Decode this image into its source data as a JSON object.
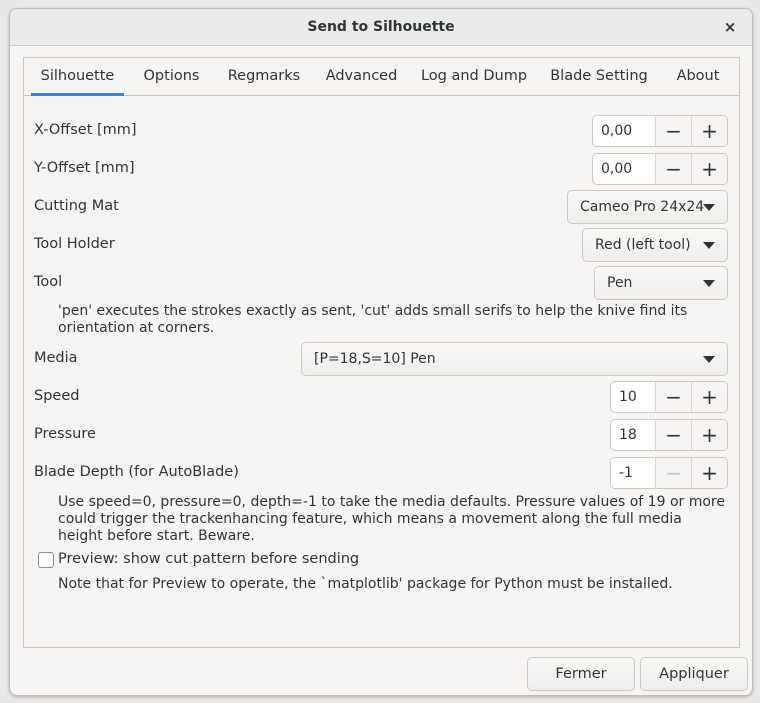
{
  "window": {
    "title": "Send to Silhouette",
    "close_glyph": "×"
  },
  "tabs": [
    {
      "label": "Silhouette",
      "active": true
    },
    {
      "label": "Options"
    },
    {
      "label": "Regmarks"
    },
    {
      "label": "Advanced"
    },
    {
      "label": "Log and Dump"
    },
    {
      "label": "Blade Setting"
    },
    {
      "label": "About"
    }
  ],
  "fields": {
    "x_offset": {
      "label": "X-Offset [mm]",
      "value": "0,00"
    },
    "y_offset": {
      "label": "Y-Offset [mm]",
      "value": "0,00"
    },
    "cutting_mat": {
      "label": "Cutting Mat",
      "value": "Cameo Pro 24x24"
    },
    "tool_holder": {
      "label": "Tool Holder",
      "value": "Red (left tool)"
    },
    "tool": {
      "label": "Tool",
      "value": "Pen"
    },
    "media": {
      "label": "Media",
      "value": "[P=18,S=10] Pen"
    },
    "speed": {
      "label": "Speed",
      "value": "10"
    },
    "pressure": {
      "label": "Pressure",
      "value": "18"
    },
    "blade_depth": {
      "label": "Blade Depth (for AutoBlade)",
      "value": "-1"
    }
  },
  "notes": {
    "tool_note": "'pen' executes the strokes exactly as sent, 'cut' adds small serifs to help the knive find its orientation at corners.",
    "defaults_note": "Use speed=0, pressure=0, depth=-1 to take the media defaults. Pressure values of 19 or more could trigger the trackenhancing feature, which means a movement along the full media height before start. Beware.",
    "preview_note": "Note that for Preview to operate, the `matplotlib' package for Python must be installed."
  },
  "preview": {
    "label": "Preview: show cut pattern before sending",
    "checked": false
  },
  "spin_glyphs": {
    "minus": "−",
    "plus": "+"
  },
  "buttons": {
    "close": "Fermer",
    "apply": "Appliquer"
  },
  "colors": {
    "accent": "#3584e4"
  }
}
